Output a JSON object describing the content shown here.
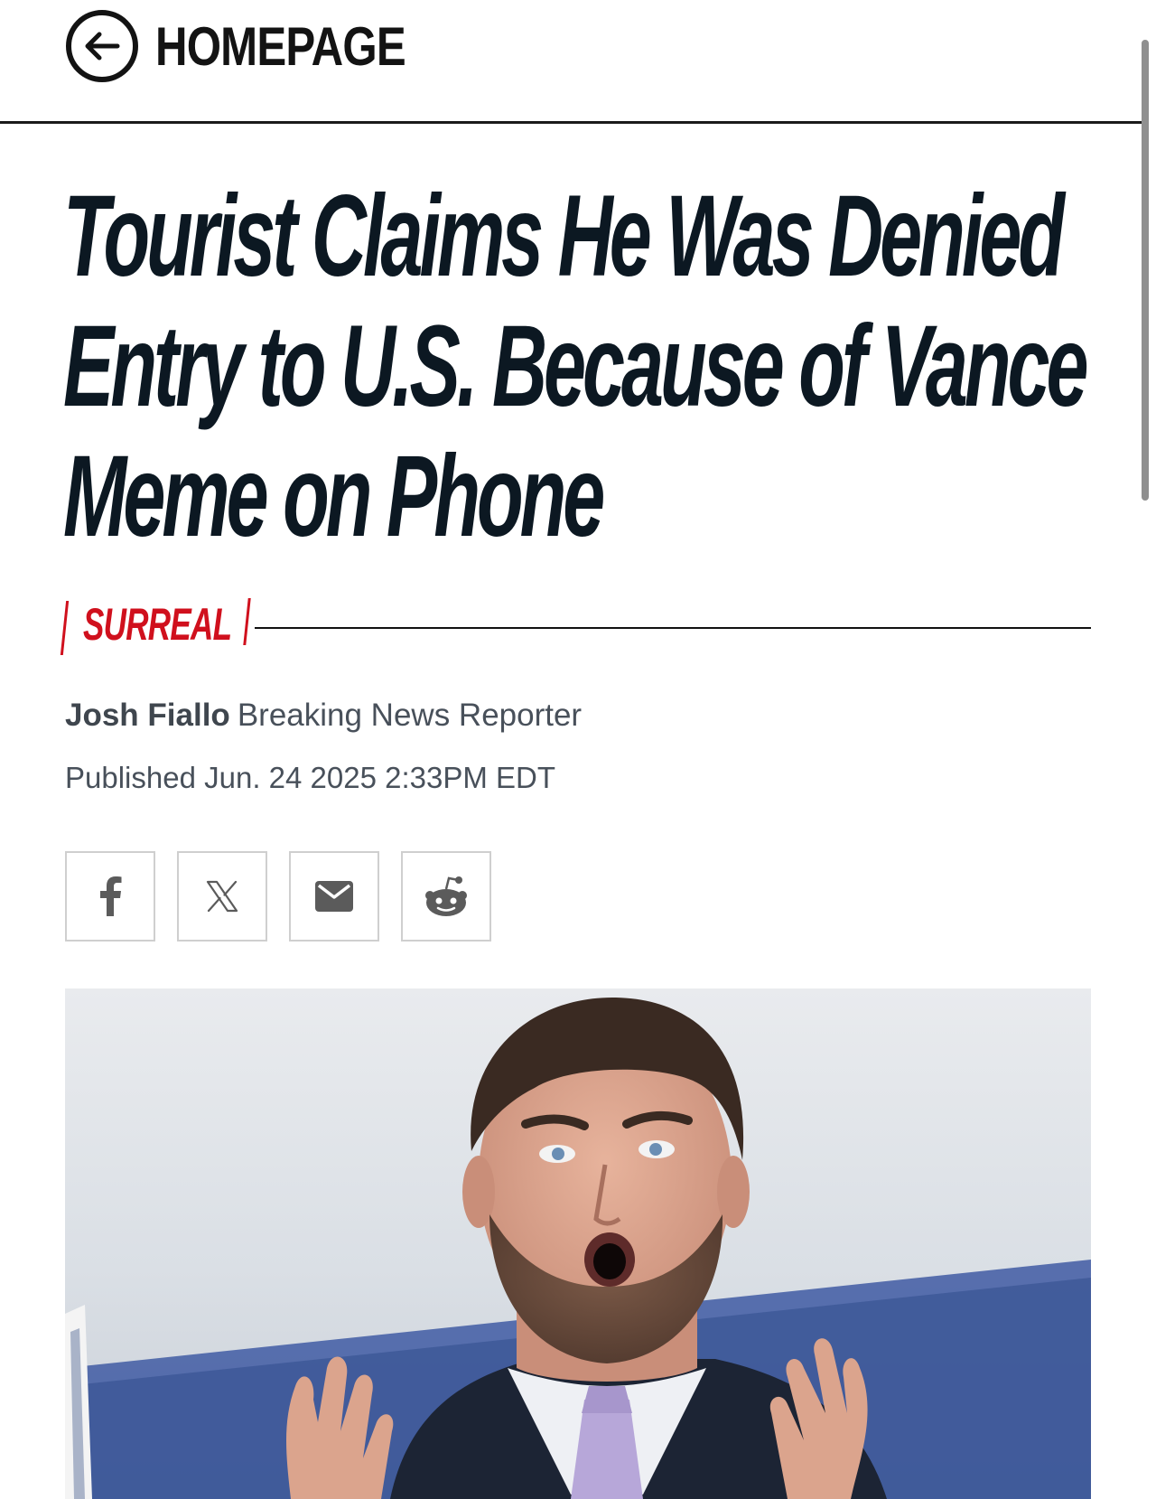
{
  "header": {
    "home_label": "HOMEPAGE",
    "back_icon": "arrow-left-circle-icon"
  },
  "article": {
    "headline_line1": "Tourist Claims He Was Denied",
    "headline_line2": "Entry to U.S. Because of Vance",
    "headline_line3": "Meme on Phone",
    "kicker": "SURREAL",
    "author": "Josh Fiallo",
    "author_role": "Breaking News Reporter",
    "published": "Published Jun. 24 2025 2:33PM EDT"
  },
  "share": {
    "buttons": [
      {
        "icon": "facebook-icon"
      },
      {
        "icon": "x-icon"
      },
      {
        "icon": "email-icon"
      },
      {
        "icon": "reddit-icon"
      }
    ]
  },
  "colors": {
    "accent": "#d0101d",
    "text": "#0c1822",
    "muted": "#48505a"
  }
}
